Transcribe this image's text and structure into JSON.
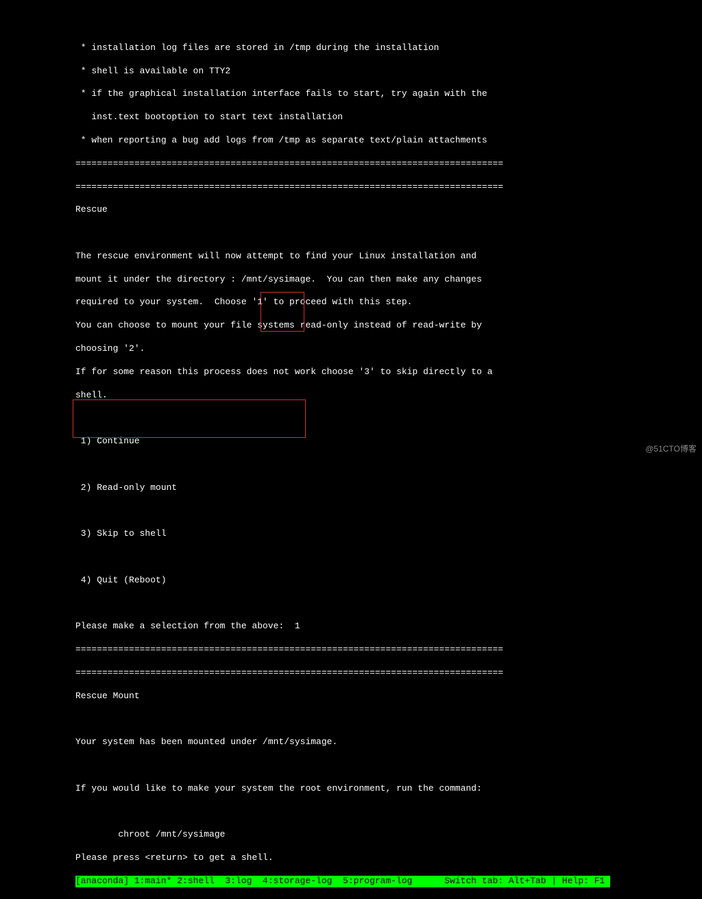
{
  "intro": {
    "l1": " * installation log files are stored in /tmp during the installation",
    "l2": " * shell is available on TTY2",
    "l3": " * if the graphical installation interface fails to start, try again with the",
    "l4": "   inst.text bootoption to start text installation",
    "l5": " * when reporting a bug add logs from /tmp as separate text/plain attachments"
  },
  "sep1": "================================================================================",
  "sep2": "================================================================================",
  "rescue": {
    "title": "Rescue",
    "p1": "The rescue environment will now attempt to find your Linux installation and",
    "p2": "mount it under the directory : /mnt/sysimage.  You can then make any changes",
    "p3": "required to your system.  Choose '1' to proceed with this step.",
    "p4": "You can choose to mount your file systems read-only instead of read-write by",
    "p5": "choosing '2'.",
    "p6": "If for some reason this process does not work choose '3' to skip directly to a",
    "p7": "shell."
  },
  "options": {
    "o1": " 1) Continue",
    "o2": " 2) Read-only mount",
    "o3": " 3) Skip to shell",
    "o4": " 4) Quit (Reboot)"
  },
  "prompt": {
    "text": "Please make a selection from the above:  1"
  },
  "sep3": "================================================================================",
  "sep4": "================================================================================",
  "mount": {
    "title": "Rescue Mount",
    "p1": "Your system has been mounted under /mnt/sysimage.",
    "p2": "If you would like to make your system the root environment, run the command:",
    "cmd": "        chroot /mnt/sysimage",
    "hint": "Please press <return> to get a shell."
  },
  "statusbar": {
    "left": "[anaconda] 1:main* 2:shell  3:log  4:storage-log  5:program-log     ",
    "right": " Switch tab: Alt+Tab | Help: F1 "
  },
  "watermark": "@51CTO博客"
}
